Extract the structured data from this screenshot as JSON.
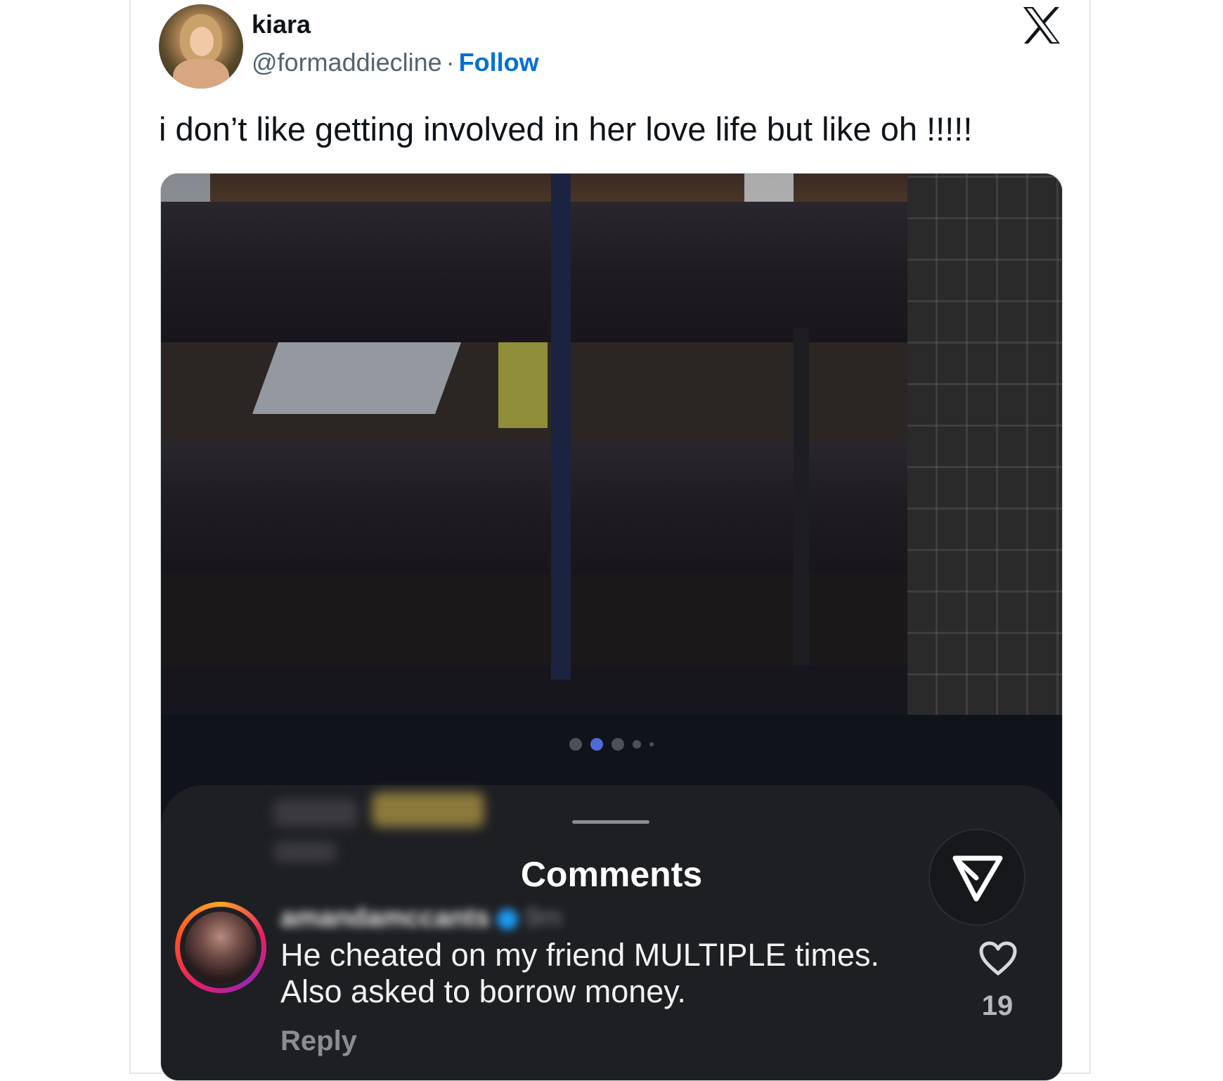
{
  "tweet": {
    "author_name": "kiara",
    "handle": "@formaddiecline",
    "separator": "·",
    "follow_label": "Follow",
    "text": "i don’t like getting involved in her love life but like oh !!!!!",
    "platform_icon": "x-logo-icon",
    "accent_color": "#006fd6"
  },
  "embedded_post": {
    "carousel": {
      "dot_count": 5,
      "active_index": 1,
      "active_color": "#4f6bd8"
    },
    "comments_sheet": {
      "title": "Comments",
      "send_icon": "send-icon",
      "comment": {
        "username": "amandamccants",
        "time": "9m",
        "text_line1": "He cheated on my friend MULTIPLE times.",
        "text_line2": "Also asked to borrow money.",
        "reply_label": "Reply",
        "like_count": "19",
        "like_icon": "heart-icon"
      }
    }
  }
}
